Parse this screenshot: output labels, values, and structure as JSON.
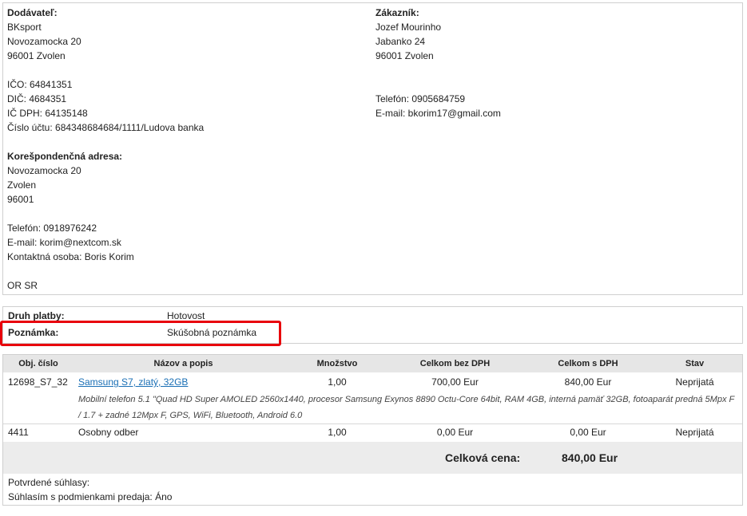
{
  "supplier": {
    "heading": "Dodávateľ:",
    "name": "BKsport",
    "street": "Novozamocka 20",
    "city": "96001 Zvolen",
    "ico": "IČO: 64841351",
    "dic": "DIČ: 4684351",
    "icdph": "IČ DPH: 64135148",
    "account": "Číslo účtu: 684348684684/1111/Ludova banka",
    "corr_heading": "Korešpondenčná adresa:",
    "corr_street": "Novozamocka 20",
    "corr_city": "Zvolen",
    "corr_zip": "96001",
    "phone": "Telefón: 0918976242",
    "email": "E-mail: korim@nextcom.sk",
    "contact": "Kontaktná osoba: Boris Korim",
    "register": "OR SR"
  },
  "customer": {
    "heading": "Zákazník:",
    "name": "Jozef Mourinho",
    "street": "Jabanko 24",
    "city": "96001 Zvolen",
    "phone": "Telefón: 0905684759",
    "email": "E-mail: bkorim17@gmail.com"
  },
  "payment": {
    "method_label": "Druh platby:",
    "method_value": "Hotovost",
    "note_label": "Poznámka:",
    "note_value": "Skúšobná poznámka",
    "highlight_color": "#e8000b"
  },
  "table": {
    "headers": [
      "Obj. číslo",
      "Názov a popis",
      "Množstvo",
      "Celkom bez DPH",
      "Celkom s DPH",
      "Stav"
    ],
    "rows": [
      {
        "code": "12698_S7_32",
        "name": "Samsung S7, zlatý, 32GB",
        "qty": "1,00",
        "net": "700,00 Eur",
        "gross": "840,00 Eur",
        "status": "Neprijatá",
        "description": "Mobilní telefon 5.1 \"Quad HD Super AMOLED 2560x1440, procesor Samsung Exynos 8890 Octu-Core 64bit, RAM 4GB, interná pamäť 32GB, fotoaparát predná 5Mpx F / 1.7 + zadné 12Mpx F, GPS, WiFi, Bluetooth, Android 6.0"
      },
      {
        "code": "4411",
        "name": "Osobny odber",
        "qty": "1,00",
        "net": "0,00 Eur",
        "gross": "0,00 Eur",
        "status": "Neprijatá"
      }
    ],
    "total_label": "Celková cena:",
    "total_value": "840,00 Eur"
  },
  "consents": {
    "heading": "Potvrdené súhlasy:",
    "terms": "Súhlasím s podmienkami predaja: Áno"
  }
}
